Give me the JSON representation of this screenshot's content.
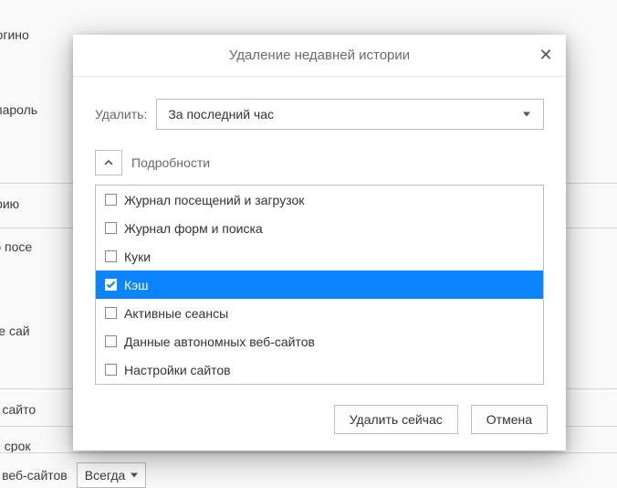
{
  "bg": {
    "t1": "ние логино",
    "t2": "пароль",
    "t3": "ь историю",
    "t4": "рию посе",
    "t5": "анные сай",
    "t6": "ные сайто",
    "t7": "ения срок",
    "t8": "ные сайтов со сторонних веб-сайтов",
    "select8": "Всегда"
  },
  "dialog": {
    "title": "Удаление недавней истории",
    "delete_label": "Удалить:",
    "range": "За последний час",
    "details_label": "Подробности",
    "items": [
      {
        "label": "Журнал посещений и загрузок",
        "checked": false
      },
      {
        "label": "Журнал форм и поиска",
        "checked": false
      },
      {
        "label": "Куки",
        "checked": false
      },
      {
        "label": "Кэш",
        "checked": true
      },
      {
        "label": "Активные сеансы",
        "checked": false
      },
      {
        "label": "Данные автономных веб-сайтов",
        "checked": false
      },
      {
        "label": "Настройки сайтов",
        "checked": false
      }
    ],
    "ok": "Удалить сейчас",
    "cancel": "Отмена"
  }
}
